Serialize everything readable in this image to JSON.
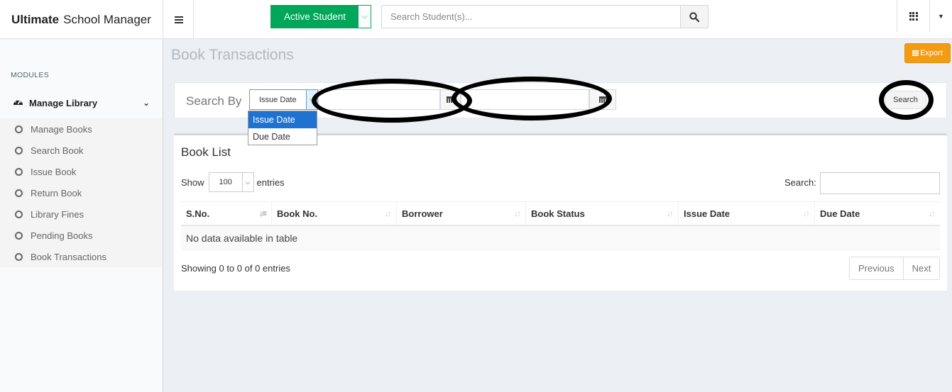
{
  "header": {
    "brand_bold": "Ultimate",
    "brand_rest": "School Manager",
    "active_student_label": "Active Student",
    "student_search_placeholder": "Search Student(s)..."
  },
  "sidebar": {
    "section_label": "MODULES",
    "group_label": "Manage Library",
    "items": [
      {
        "label": "Manage Books"
      },
      {
        "label": "Search Book"
      },
      {
        "label": "Issue Book"
      },
      {
        "label": "Return Book"
      },
      {
        "label": "Library Fines"
      },
      {
        "label": "Pending Books"
      },
      {
        "label": "Book Transactions"
      }
    ]
  },
  "page": {
    "title": "Book Transactions",
    "export_label": "Export"
  },
  "search_panel": {
    "label": "Search By",
    "date_type_selected": "Issue Date",
    "date_type_options": [
      "Issue Date",
      "Due Date"
    ],
    "search_button": "Search"
  },
  "book_list": {
    "title": "Book List",
    "show_label": "Show",
    "entries_label": "entries",
    "page_length": "100",
    "search_label": "Search:",
    "columns": [
      "S.No.",
      "Book No.",
      "Borrower",
      "Book Status",
      "Issue Date",
      "Due Date"
    ],
    "empty_message": "No data available in table",
    "info": "Showing 0 to 0 of 0 entries",
    "prev_label": "Previous",
    "next_label": "Next"
  },
  "colors": {
    "accent_green": "#00a65a",
    "export_orange": "#f39c12",
    "selected_option": "#1e73d2"
  }
}
